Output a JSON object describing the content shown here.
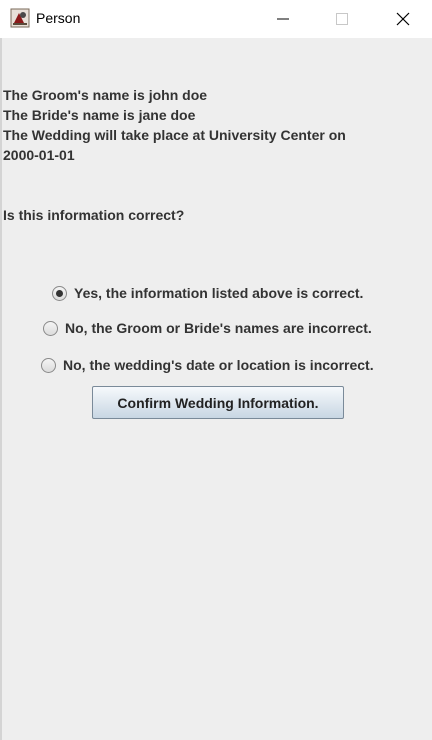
{
  "window": {
    "title": "Person"
  },
  "info": {
    "groom_line": "The Groom's name is john doe",
    "bride_line": "The Bride's name is jane doe",
    "wedding_line_1": "The Wedding will take place at University Center on",
    "wedding_line_2": "2000-01-01",
    "question": "Is this information correct?"
  },
  "options": [
    {
      "label": "Yes, the information listed above is correct.",
      "selected": true
    },
    {
      "label": "No, the Groom or Bride's names are incorrect.",
      "selected": false
    },
    {
      "label": "No, the wedding's date or location is incorrect.",
      "selected": false
    }
  ],
  "confirm_button": {
    "label": "Confirm Wedding Information."
  }
}
